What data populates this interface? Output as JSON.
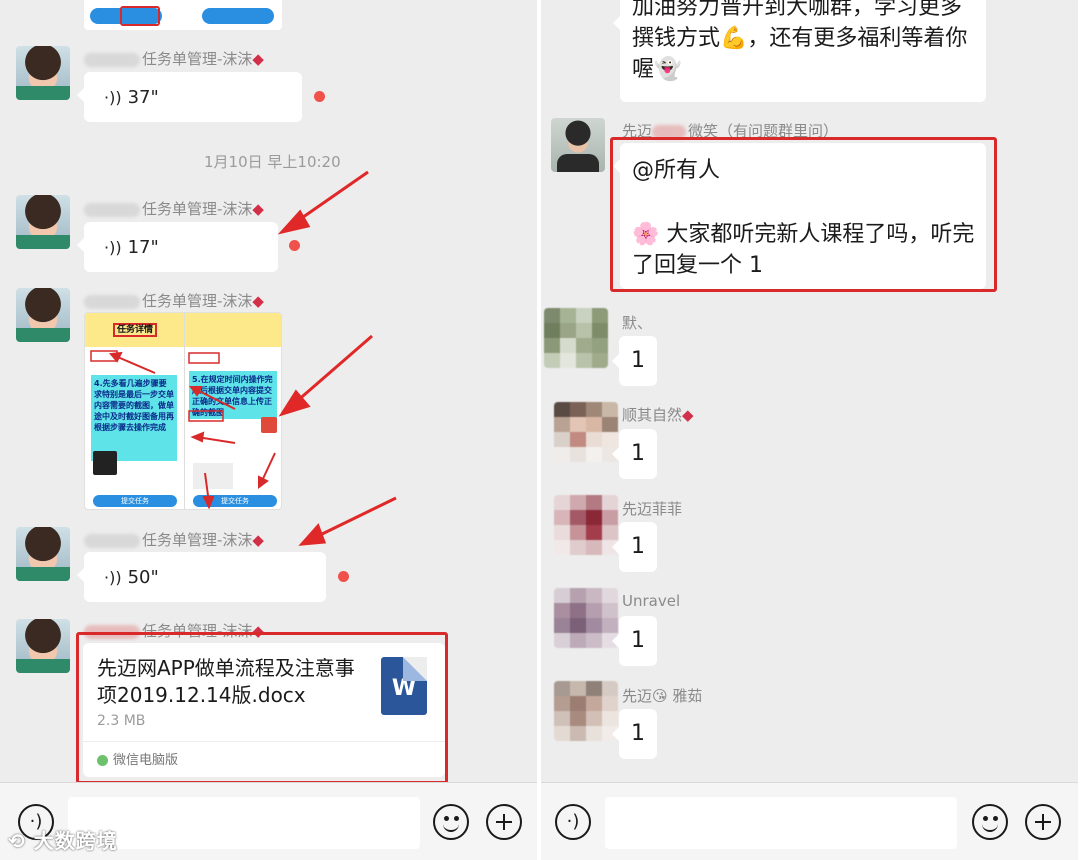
{
  "left": {
    "messages": [
      {
        "sender_suffix": "任务单管理-沫沫",
        "voice_duration": "37\""
      },
      {
        "sender_suffix": "任务单管理-沫沫",
        "voice_duration": "17\""
      },
      {
        "sender_suffix": "任务单管理-沫沫",
        "image_kind": "task-screenshot"
      },
      {
        "sender_suffix": "任务单管理-沫沫",
        "voice_duration": "50\""
      },
      {
        "sender_suffix": "任务单管理-沫沫"
      }
    ],
    "timestamp": "1月10日 早上10:20",
    "screenshot": {
      "title": "任务详情",
      "note_left": "4.先多看几遍步骤要求特别是最后一步交单内容需要的截图，做单途中及时截好图备用再根据步骤去操作完成",
      "note_right": "5.在规定时间内操作完成后根据交单内容提交正确的文单信息上传正确的截图",
      "button_label": "提交任务"
    },
    "file": {
      "name": "先迈网APP做单流程及注意事项2019.12.14版.docx",
      "size": "2.3 MB",
      "source": "微信电脑版",
      "icon_letter": "W"
    },
    "input_bar": {
      "voice_glyph": "·)",
      "watermark": "大数跨境"
    }
  },
  "right": {
    "top_message": "加油努力晋升到大咖群，学习更多撰钱方式💪，还有更多福利等着你喔👻",
    "announcement": {
      "sender_prefix": "先迈",
      "sender_suffix": "微笑（有问题群里问）",
      "line1": "@所有人",
      "line2": "🌸 大家都听完新人课程了吗，听完了回复一个 1"
    },
    "replies": [
      {
        "sender": "默、",
        "text": "1"
      },
      {
        "sender": "顺其自然",
        "text": "1"
      },
      {
        "sender": "先迈菲菲",
        "text": "1"
      },
      {
        "sender": "Unravel",
        "text": "1"
      },
      {
        "sender": "先迈😘 雅茹",
        "text": "1"
      }
    ],
    "input_bar": {
      "voice_glyph": "·)"
    }
  },
  "colors": {
    "accent_red": "#d82a2a",
    "background": "#ededed",
    "bubble": "#ffffff",
    "unread": "#f0524b",
    "word_blue": "#2b579a"
  }
}
